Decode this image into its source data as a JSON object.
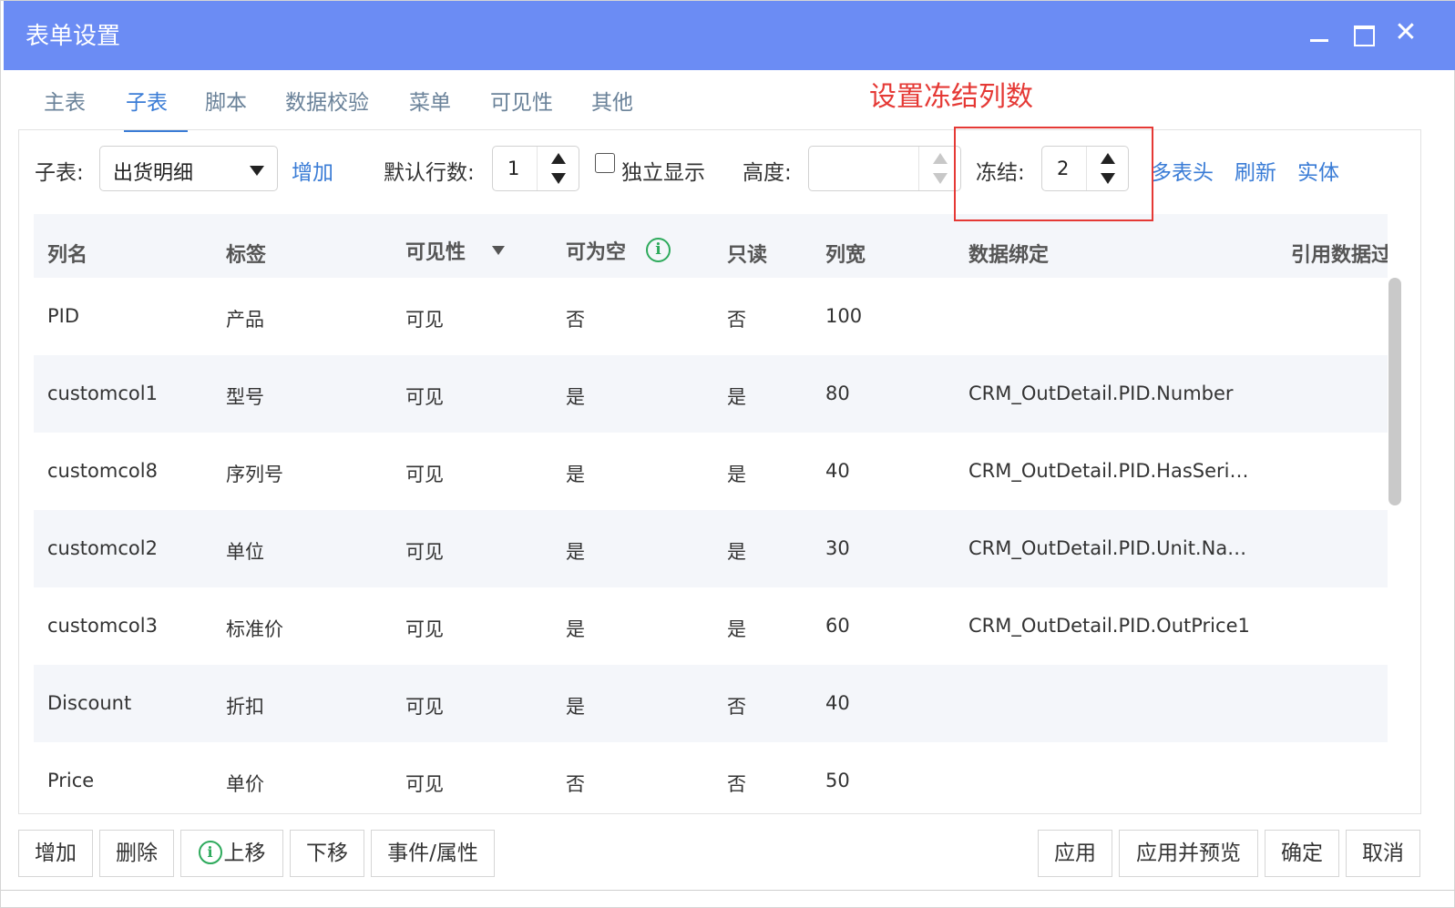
{
  "window": {
    "title": "表单设置"
  },
  "tabs": [
    "主表",
    "子表",
    "脚本",
    "数据校验",
    "菜单",
    "可见性",
    "其他"
  ],
  "active_tab": "子表",
  "annotation": "设置冻结列数",
  "toolbar": {
    "subtable_label": "子表:",
    "subtable_value": "出货明细",
    "add_link": "增加",
    "default_rows_label": "默认行数:",
    "default_rows_value": "1",
    "standalone_label": "独立显示",
    "height_label": "高度:",
    "height_value": "",
    "freeze_label": "冻结:",
    "freeze_value": "2",
    "multi_header_link": "多表头",
    "refresh_link": "刷新",
    "entity_link": "实体"
  },
  "grid": {
    "headers": [
      "列名",
      "标签",
      "可见性",
      "可为空",
      "只读",
      "列宽",
      "数据绑定",
      "引用数据过"
    ],
    "rows": [
      [
        "PID",
        "产品",
        "可见",
        "否",
        "否",
        "100",
        ""
      ],
      [
        "customcol1",
        "型号",
        "可见",
        "是",
        "是",
        "80",
        "CRM_OutDetail.PID.Number"
      ],
      [
        "customcol8",
        "序列号",
        "可见",
        "是",
        "是",
        "40",
        "CRM_OutDetail.PID.HasSeri…"
      ],
      [
        "customcol2",
        "单位",
        "可见",
        "是",
        "是",
        "30",
        "CRM_OutDetail.PID.Unit.Na…"
      ],
      [
        "customcol3",
        "标准价",
        "可见",
        "是",
        "是",
        "60",
        "CRM_OutDetail.PID.OutPrice1"
      ],
      [
        "Discount",
        "折扣",
        "可见",
        "是",
        "否",
        "40",
        ""
      ],
      [
        "Price",
        "单价",
        "可见",
        "否",
        "否",
        "50",
        ""
      ]
    ]
  },
  "footer": {
    "left_buttons": [
      "增加",
      "删除",
      "上移",
      "下移",
      "事件/属性"
    ],
    "right_buttons": [
      "应用",
      "应用并预览",
      "确定",
      "取消"
    ]
  },
  "icons": {
    "info": "info-circle-icon",
    "info_color": "#2eaa5c"
  },
  "colors": {
    "titlebar": "#6b8cf4",
    "accent": "#3a7cd6",
    "annotation": "#e53935"
  }
}
